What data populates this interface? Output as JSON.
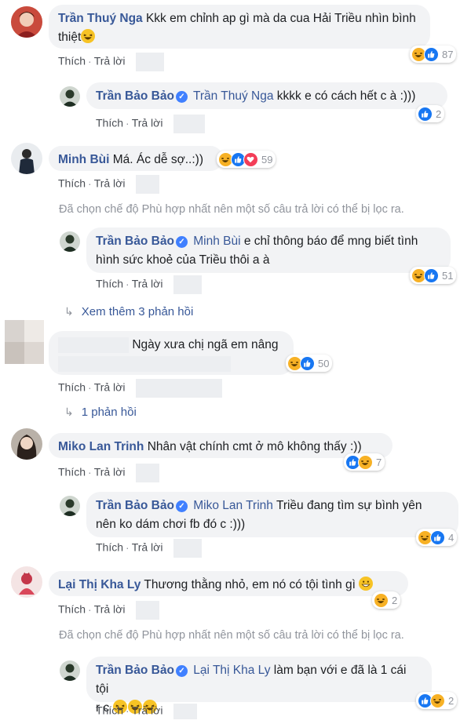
{
  "actions": {
    "like": "Thích",
    "reply": "Trả lời",
    "dot": "·"
  },
  "notice": "Đã chọn chế độ Phù hợp nhất nên một số câu trả lời có thể bị lọc ra.",
  "c1": {
    "name": "Trần Thuý Nga",
    "text1": "Kkk em chỉnh ap gì mà da cua Hải Triều nhìn bình",
    "text2": "thiệt",
    "count": "87"
  },
  "r1": {
    "name": "Trần Bảo Bảo",
    "mention": "Trần Thuý Nga",
    "text": "kkkk e có cách hết c à :)))",
    "count": "2"
  },
  "c2": {
    "name": "Minh Bùi",
    "text": "Má. Ác dễ sợ..:))",
    "count": "59"
  },
  "r2": {
    "name": "Trần Bảo Bảo",
    "mention": "Minh Bùi",
    "text1": "e chỉ thông báo để mng biết tình",
    "text2": "hình sức khoẻ của Triều thôi a à",
    "count": "51"
  },
  "more1": "Xem thêm 3 phản hồi",
  "c3": {
    "text": "Ngày xưa chị ngã em nâng",
    "count": "50"
  },
  "more2": "1 phản hồi",
  "c4": {
    "name": "Miko Lan Trinh",
    "text": "Nhân vật chính cmt ở mô không thấy :))",
    "count": "7"
  },
  "r4": {
    "name": "Trần Bảo Bảo",
    "mention": "Miko Lan Trinh",
    "text1": "Triều đang tìm sự bình yên",
    "text2": "nên ko dám chơi fb đó c :)))",
    "count": "4"
  },
  "c5": {
    "name": "Lại Thị Kha Ly",
    "text": "Thương thằng nhỏ, em nó có tội tình gì",
    "count": "2"
  },
  "r5": {
    "name": "Trần Bảo Bảo",
    "mention": "Lại Thị Kha Ly",
    "text1": "làm bạn với e đã là 1 cái tội",
    "text2": "r c",
    "count": "2"
  },
  "colors": {
    "link": "#385898",
    "muted": "#90949c",
    "bubble": "#f2f3f5"
  }
}
